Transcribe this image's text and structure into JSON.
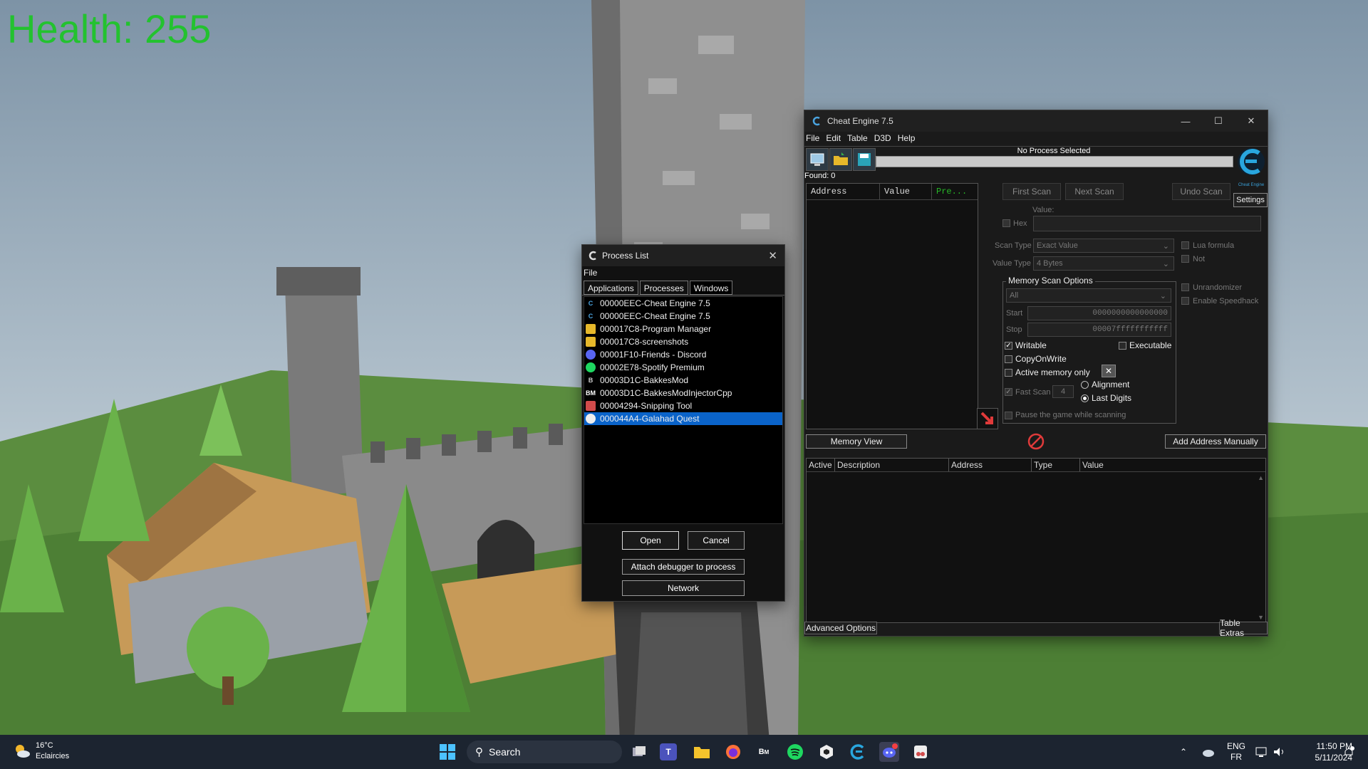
{
  "game": {
    "health_text": "Health: 255"
  },
  "cheat_engine": {
    "title": "Cheat Engine 7.5",
    "menu": [
      "File",
      "Edit",
      "Table",
      "D3D",
      "Help"
    ],
    "process_label": "No Process Selected",
    "found": "Found: 0",
    "columns": [
      "Address",
      "Value",
      "Pre..."
    ],
    "buttons": {
      "first_scan": "First Scan",
      "next_scan": "Next Scan",
      "undo_scan": "Undo Scan",
      "settings": "Settings",
      "memory_view": "Memory View",
      "add_address": "Add Address Manually",
      "advanced_options": "Advanced Options",
      "table_extras": "Table Extras"
    },
    "value_label": "Value:",
    "hex_label": "Hex",
    "scan_type_label": "Scan Type",
    "scan_type_value": "Exact Value",
    "value_type_label": "Value Type",
    "value_type_value": "4 Bytes",
    "lua_formula": "Lua formula",
    "not_label": "Not",
    "memory_scan_options": "Memory Scan Options",
    "region_value": "All",
    "start_label": "Start",
    "start_value": "0000000000000000",
    "stop_label": "Stop",
    "stop_value": "00007fffffffffff",
    "writable": "Writable",
    "executable": "Executable",
    "copy_on_write": "CopyOnWrite",
    "active_memory_only": "Active memory only",
    "fast_scan": "Fast Scan",
    "fast_scan_value": "4",
    "alignment": "Alignment",
    "last_digits": "Last Digits",
    "pause_game": "Pause the game while scanning",
    "unrandomizer": "Unrandomizer",
    "enable_speedhack": "Enable Speedhack",
    "table_columns": [
      "Active",
      "Description",
      "Address",
      "Type",
      "Value"
    ],
    "logo_caption": "Cheat Engine"
  },
  "process_list": {
    "title": "Process List",
    "menu": "File",
    "tabs": [
      "Applications",
      "Processes",
      "Windows"
    ],
    "items": [
      "00000EEC-Cheat Engine 7.5",
      "00000EEC-Cheat Engine 7.5",
      "000017C8-Program Manager",
      "000017C8-screenshots",
      "00001F10-Friends - Discord",
      "00002E78-Spotify Premium",
      "00003D1C-BakkesMod",
      "00003D1C-BakkesModInjectorCpp",
      "00004294-Snipping Tool",
      "000044A4-Galahad Quest"
    ],
    "buttons": {
      "open": "Open",
      "cancel": "Cancel",
      "attach": "Attach debugger to process",
      "network": "Network"
    }
  },
  "taskbar": {
    "weather_temp": "16°C",
    "weather_text": "Eclaircies",
    "search_placeholder": "Search",
    "lang_top": "ENG",
    "lang_bottom": "FR",
    "time": "11:50 PM",
    "date": "5/11/2024"
  }
}
